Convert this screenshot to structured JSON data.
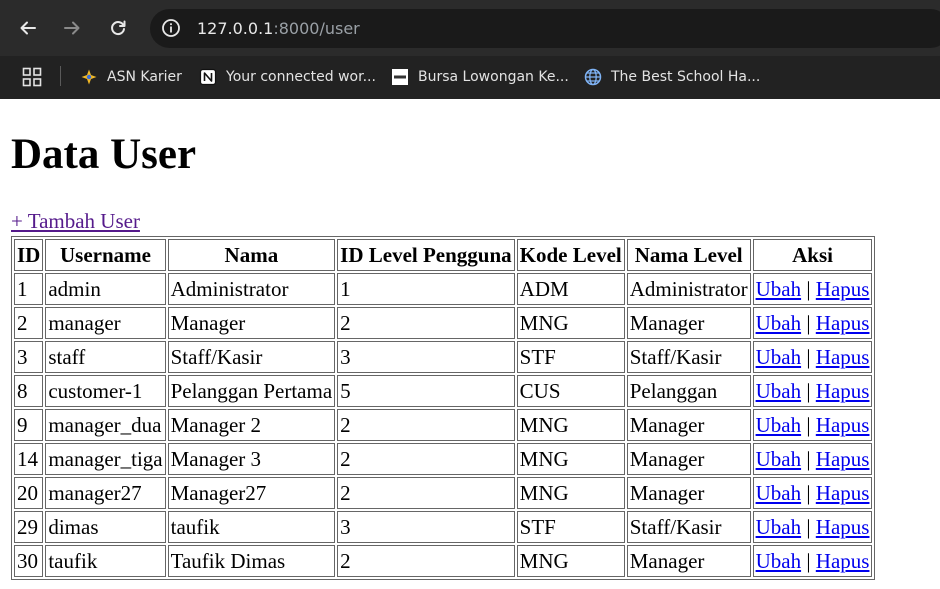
{
  "browser": {
    "url_host": "127.0.0.1",
    "url_rest": ":8000/user",
    "bookmarks": [
      {
        "label": "ASN Karier",
        "icon": "asn-star-icon"
      },
      {
        "label": "Your connected wor...",
        "icon": "notion-icon"
      },
      {
        "label": "Bursa Lowongan Ke...",
        "icon": "jobid-icon"
      },
      {
        "label": "The Best School Ha...",
        "icon": "globe-icon"
      }
    ]
  },
  "page": {
    "title": "Data User",
    "add_link": "+ Tambah User"
  },
  "table": {
    "headers": [
      "ID",
      "Username",
      "Nama",
      "ID Level Pengguna",
      "Kode Level",
      "Nama Level",
      "Aksi"
    ],
    "edit_label": "Ubah",
    "separator": "|",
    "delete_label": "Hapus",
    "rows": [
      {
        "id": "1",
        "username": "admin",
        "nama": "Administrator",
        "level_id": "1",
        "level_kode": "ADM",
        "level_nama": "Administrator"
      },
      {
        "id": "2",
        "username": "manager",
        "nama": "Manager",
        "level_id": "2",
        "level_kode": "MNG",
        "level_nama": "Manager"
      },
      {
        "id": "3",
        "username": "staff",
        "nama": "Staff/Kasir",
        "level_id": "3",
        "level_kode": "STF",
        "level_nama": "Staff/Kasir"
      },
      {
        "id": "8",
        "username": "customer-1",
        "nama": "Pelanggan Pertama",
        "level_id": "5",
        "level_kode": "CUS",
        "level_nama": "Pelanggan"
      },
      {
        "id": "9",
        "username": "manager_dua",
        "nama": "Manager 2",
        "level_id": "2",
        "level_kode": "MNG",
        "level_nama": "Manager"
      },
      {
        "id": "14",
        "username": "manager_tiga",
        "nama": "Manager 3",
        "level_id": "2",
        "level_kode": "MNG",
        "level_nama": "Manager"
      },
      {
        "id": "20",
        "username": "manager27",
        "nama": "Manager27",
        "level_id": "2",
        "level_kode": "MNG",
        "level_nama": "Manager"
      },
      {
        "id": "29",
        "username": "dimas",
        "nama": "taufik",
        "level_id": "3",
        "level_kode": "STF",
        "level_nama": "Staff/Kasir"
      },
      {
        "id": "30",
        "username": "taufik",
        "nama": "Taufik Dimas",
        "level_id": "2",
        "level_kode": "MNG",
        "level_nama": "Manager"
      }
    ]
  }
}
